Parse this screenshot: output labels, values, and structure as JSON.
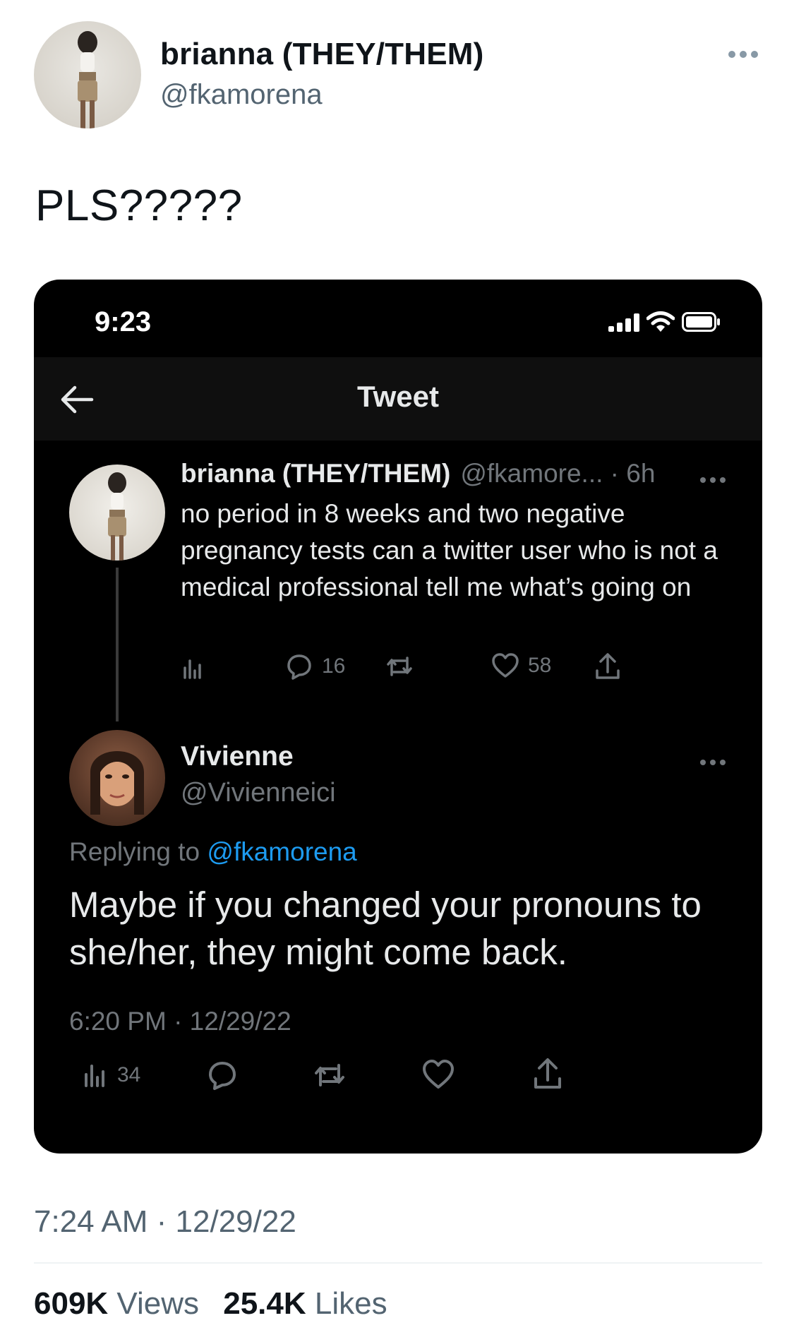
{
  "tweet": {
    "author_name": "brianna (THEY/THEM)",
    "author_handle": "@fkamorena",
    "text": "PLS?????",
    "timestamp": "7:24 AM · 12/29/22",
    "views_count": "609K",
    "views_label": "Views",
    "likes_count": "25.4K",
    "likes_label": "Likes"
  },
  "embedded": {
    "status_time": "9:23",
    "nav_title": "Tweet",
    "parent": {
      "name": "brianna (THEY/THEM)",
      "handle_time": "@fkamore... · 6h",
      "text": "no period in 8 weeks and two negative pregnancy tests can a twitter user who is not a medical professional tell me what’s going on",
      "reply_count": "16",
      "like_count": "58"
    },
    "reply": {
      "name": "Vivienne",
      "handle": "@Vivienneici",
      "replying_prefix": "Replying to",
      "replying_to": "@fkamorena",
      "text": "Maybe if you changed your pronouns to she/her, they might come back.",
      "timestamp": "6:20 PM · 12/29/22",
      "view_count": "34"
    }
  },
  "icons": [
    "more-icon",
    "back-arrow-icon",
    "signal-icon",
    "wifi-icon",
    "battery-icon",
    "analytics-icon",
    "reply-icon",
    "retweet-icon",
    "like-icon",
    "share-icon"
  ],
  "colors": {
    "link": "#1d9bf0",
    "muted_light": "#536471",
    "muted_dark": "#71767b",
    "card_bg": "#000000"
  }
}
